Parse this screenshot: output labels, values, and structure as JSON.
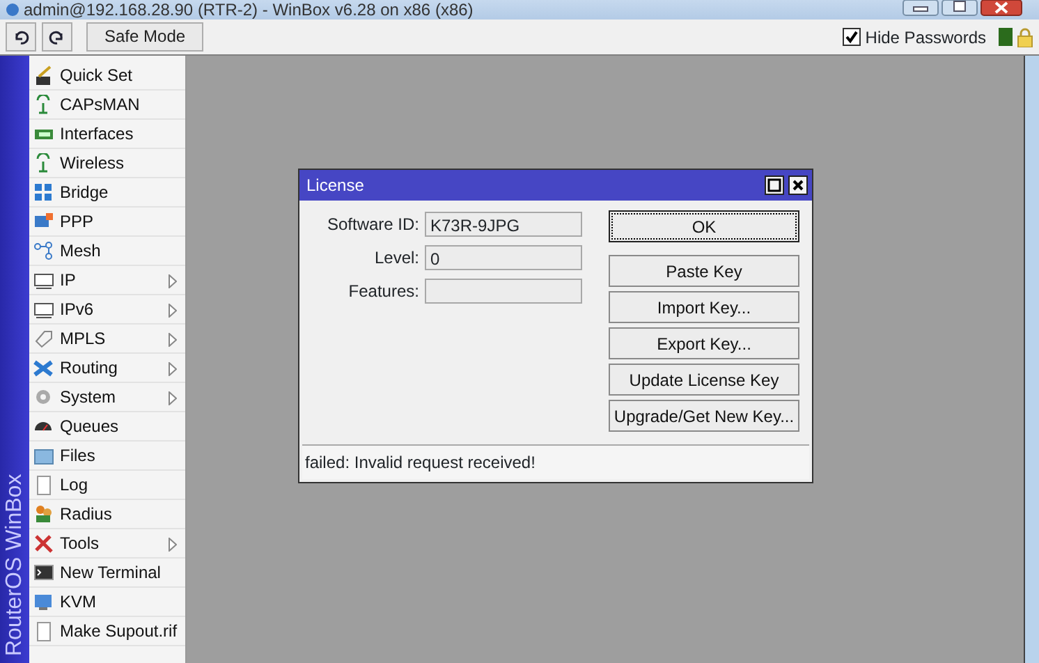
{
  "window": {
    "title": "admin@192.168.28.90 (RTR-2) - WinBox v6.28 on x86 (x86)"
  },
  "toolbar": {
    "safe_mode": "Safe Mode",
    "hide_passwords": {
      "label": "Hide Passwords",
      "checked": true
    }
  },
  "sidebar": {
    "brand": "RouterOS WinBox",
    "items": [
      {
        "label": "Quick Set",
        "submenu": false
      },
      {
        "label": "CAPsMAN",
        "submenu": false
      },
      {
        "label": "Interfaces",
        "submenu": false
      },
      {
        "label": "Wireless",
        "submenu": false
      },
      {
        "label": "Bridge",
        "submenu": false
      },
      {
        "label": "PPP",
        "submenu": false
      },
      {
        "label": "Mesh",
        "submenu": false
      },
      {
        "label": "IP",
        "submenu": true
      },
      {
        "label": "IPv6",
        "submenu": true
      },
      {
        "label": "MPLS",
        "submenu": true
      },
      {
        "label": "Routing",
        "submenu": true
      },
      {
        "label": "System",
        "submenu": true
      },
      {
        "label": "Queues",
        "submenu": false
      },
      {
        "label": "Files",
        "submenu": false
      },
      {
        "label": "Log",
        "submenu": false
      },
      {
        "label": "Radius",
        "submenu": false
      },
      {
        "label": "Tools",
        "submenu": true
      },
      {
        "label": "New Terminal",
        "submenu": false
      },
      {
        "label": "KVM",
        "submenu": false
      },
      {
        "label": "Make Supout.rif",
        "submenu": false
      }
    ]
  },
  "dialog": {
    "title": "License",
    "fields": [
      {
        "label": "Software ID:",
        "value": "K73R-9JPG"
      },
      {
        "label": "Level:",
        "value": "0"
      },
      {
        "label": "Features:"
      }
    ],
    "buttons": [
      {
        "label": "OK",
        "focused": true
      },
      {
        "label": "Paste Key",
        "focused": false
      },
      {
        "label": "Import Key...",
        "focused": false
      },
      {
        "label": "Export Key...",
        "focused": false
      },
      {
        "label": "Update License Key",
        "focused": false
      },
      {
        "label": "Upgrade/Get New Key...",
        "focused": false
      }
    ],
    "status": "failed: Invalid request received!"
  }
}
